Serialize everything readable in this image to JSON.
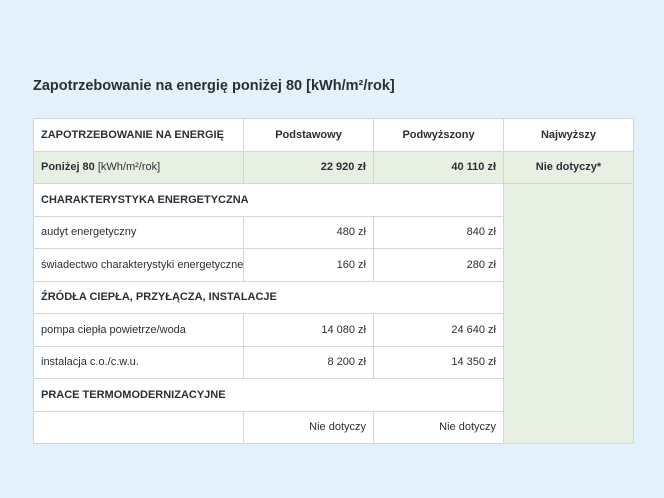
{
  "page": {
    "title": "Zapotrzebowanie na energię poniżej 80 [kWh/m²/rok]"
  },
  "table": {
    "headers": [
      "ZAPOTRZEBOWANIE NA ENERGIĘ",
      "Podstawowy",
      "Podwyższony",
      "Najwyższy"
    ],
    "summary": {
      "label": "Poniżej 80",
      "unit": "[kWh/m²/rok]",
      "podstawowy": "22 920 zł",
      "podwyzszony": "40 110 zł",
      "najwyzszy": "Nie dotyczy*"
    },
    "sections": [
      {
        "title": "CHARAKTERYSTYKA ENERGETYCZNA",
        "rows": [
          {
            "label": "audyt energetyczny",
            "podstawowy": "480 zł",
            "podwyzszony": "840 zł"
          },
          {
            "label": "świadectwo charakterystyki energetycznej",
            "podstawowy": "160 zł",
            "podwyzszony": "280 zł"
          }
        ]
      },
      {
        "title": "ŹRÓDŁA CIEPŁA, PRZYŁĄCZA, INSTALACJE",
        "rows": [
          {
            "label": "pompa ciepła powietrze/woda",
            "podstawowy": "14 080 zł",
            "podwyzszony": "24 640 zł"
          },
          {
            "label": "instalacja c.o./c.w.u.",
            "podstawowy": "8 200 zł",
            "podwyzszony": "14 350 zł"
          }
        ]
      },
      {
        "title": "PRACE TERMOMODERNIZACYJNE",
        "rows": [
          {
            "label": "",
            "podstawowy": "Nie dotyczy",
            "podwyzszony": "Nie dotyczy"
          }
        ]
      }
    ]
  }
}
